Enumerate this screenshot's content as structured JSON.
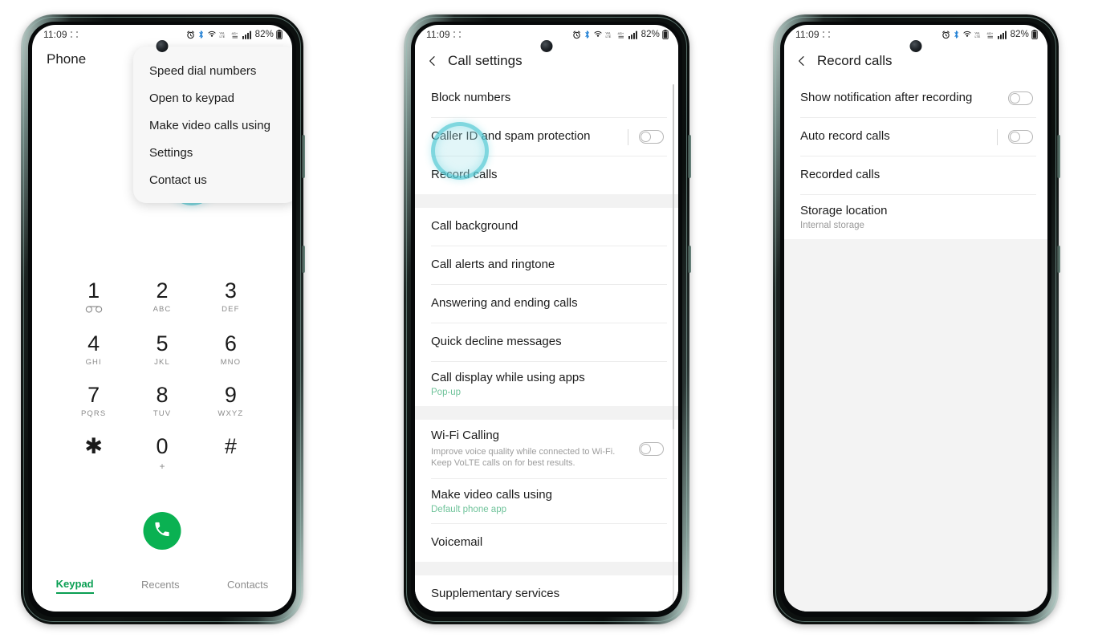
{
  "status_bar": {
    "time": "11:09",
    "battery_percent": "82%",
    "icons": [
      "alarm-icon",
      "bluetooth-icon",
      "wifi-calling-icon",
      "volte-icon",
      "4g-plus-icon",
      "signal-bars-icon",
      "battery-icon"
    ]
  },
  "phone1": {
    "title": "Phone",
    "menu": {
      "items": [
        {
          "label": "Speed dial numbers"
        },
        {
          "label": "Open to keypad"
        },
        {
          "label": "Make video calls using"
        },
        {
          "label": "Settings",
          "highlighted": true
        },
        {
          "label": "Contact us"
        }
      ]
    },
    "keypad": [
      {
        "digit": "1",
        "sub": "⌀⌀",
        "is_voicemail": true
      },
      {
        "digit": "2",
        "sub": "ABC"
      },
      {
        "digit": "3",
        "sub": "DEF"
      },
      {
        "digit": "4",
        "sub": "GHI"
      },
      {
        "digit": "5",
        "sub": "JKL"
      },
      {
        "digit": "6",
        "sub": "MNO"
      },
      {
        "digit": "7",
        "sub": "PQRS"
      },
      {
        "digit": "8",
        "sub": "TUV"
      },
      {
        "digit": "9",
        "sub": "WXYZ"
      },
      {
        "digit": "✱",
        "sub": ""
      },
      {
        "digit": "0",
        "sub": "+"
      },
      {
        "digit": "#",
        "sub": ""
      }
    ],
    "call_button": "call-icon",
    "tabs": [
      {
        "label": "Keypad",
        "active": true
      },
      {
        "label": "Recents",
        "active": false
      },
      {
        "label": "Contacts",
        "active": false
      }
    ]
  },
  "phone2": {
    "title": "Call settings",
    "back": "back-icon",
    "groups": [
      {
        "rows": [
          {
            "title": "Block numbers"
          },
          {
            "title": "Caller ID and spam protection",
            "toggle": "off",
            "divider": true
          },
          {
            "title": "Record calls",
            "highlighted": true
          }
        ]
      },
      {
        "rows": [
          {
            "title": "Call background"
          },
          {
            "title": "Call alerts and ringtone"
          },
          {
            "title": "Answering and ending calls"
          },
          {
            "title": "Quick decline messages"
          },
          {
            "title": "Call display while using apps",
            "subtitle": "Pop-up"
          }
        ]
      },
      {
        "rows": [
          {
            "title": "Wi-Fi Calling",
            "desc": "Improve voice quality while connected to Wi-Fi. Keep VoLTE calls on for best results.",
            "toggle": "off"
          },
          {
            "title": "Make video calls using",
            "subtitle": "Default phone app"
          },
          {
            "title": "Voicemail"
          }
        ]
      },
      {
        "rows": [
          {
            "title": "Supplementary services"
          }
        ]
      }
    ]
  },
  "phone3": {
    "title": "Record calls",
    "back": "back-icon",
    "groups": [
      {
        "rows": [
          {
            "title": "Show notification after recording",
            "toggle": "off"
          },
          {
            "title": "Auto record calls",
            "toggle": "off",
            "divider": true
          },
          {
            "title": "Recorded calls"
          },
          {
            "title": "Storage location",
            "subtitle_gray": "Internal storage"
          }
        ]
      }
    ]
  },
  "colors": {
    "accent_green": "#0a9f53",
    "call_green": "#0ab152",
    "teal_highlight": "#42c4d1",
    "subtitle_green": "#6fc39a"
  }
}
